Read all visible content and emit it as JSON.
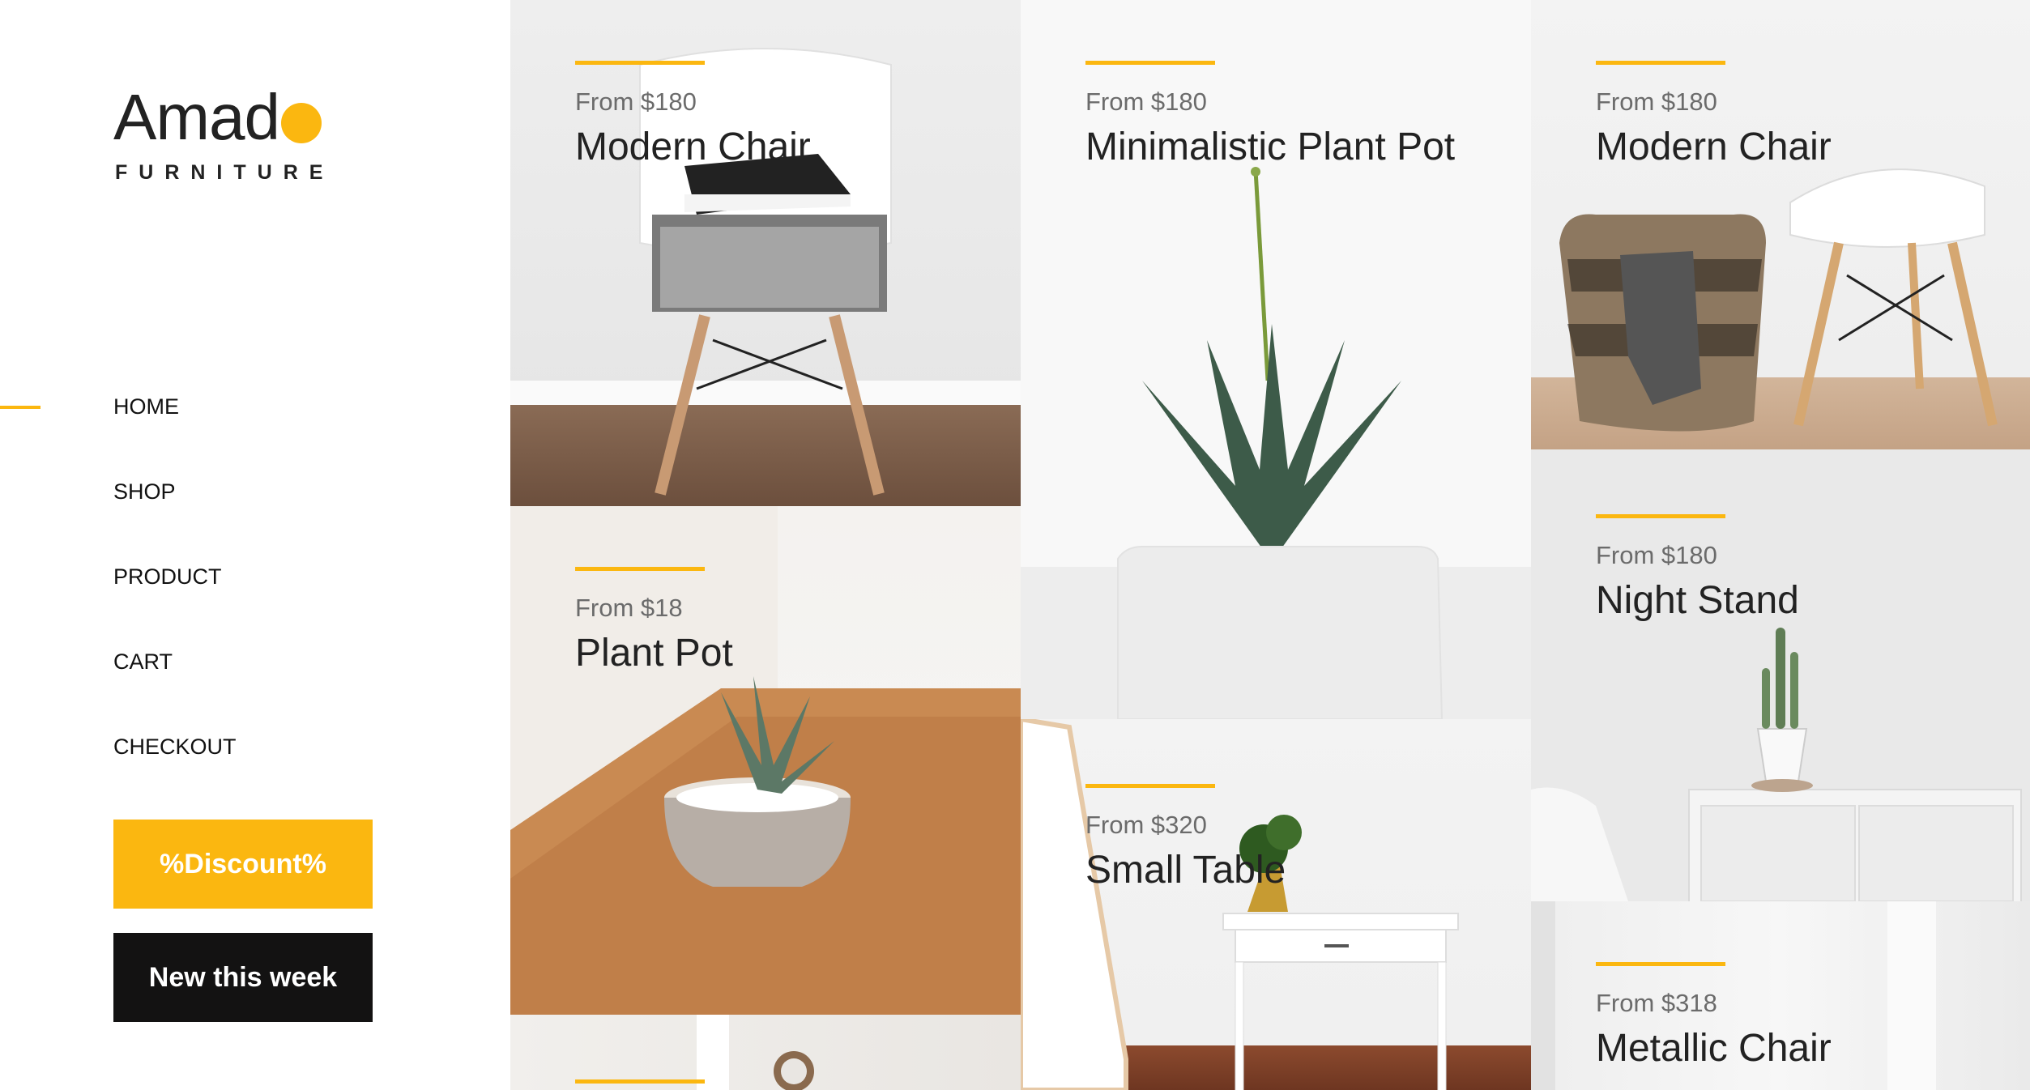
{
  "brand": {
    "name": "Amad",
    "tagline": "FURNITURE",
    "accent_color": "#fbb710",
    "dark_color": "#131212"
  },
  "nav": {
    "items": [
      {
        "label": "HOME",
        "active": true
      },
      {
        "label": "SHOP",
        "active": false
      },
      {
        "label": "PRODUCT",
        "active": false
      },
      {
        "label": "CART",
        "active": false
      },
      {
        "label": "CHECKOUT",
        "active": false
      }
    ]
  },
  "buttons": {
    "discount": "%Discount%",
    "new_this_week": "New this week"
  },
  "products": [
    {
      "price": "From $180",
      "name": "Modern Chair",
      "image": "chair-with-sneakers"
    },
    {
      "price": "From $18",
      "name": "Plant Pot",
      "image": "succulent-pot-on-table"
    },
    {
      "price": "",
      "name": "",
      "image": "mirror-interior"
    },
    {
      "price": "From $180",
      "name": "Minimalistic Plant Pot",
      "image": "aloe-in-white-pot"
    },
    {
      "price": "From $320",
      "name": "Small Table",
      "image": "white-console-table"
    },
    {
      "price": "From $180",
      "name": "Modern Chair",
      "image": "chair-with-basket"
    },
    {
      "price": "From $180",
      "name": "Night Stand",
      "image": "cactus-on-nightstand"
    },
    {
      "price": "From $318",
      "name": "Metallic Chair",
      "image": "white-room"
    }
  ]
}
